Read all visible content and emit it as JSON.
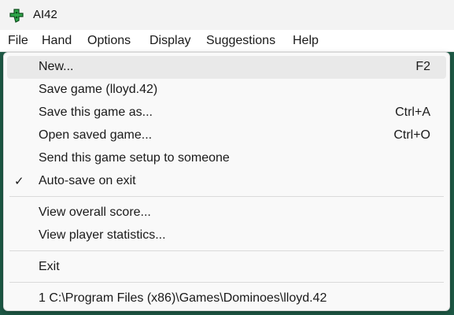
{
  "window": {
    "title": "AI42",
    "icon": "green-domino-app-icon"
  },
  "menubar": {
    "items": [
      "File",
      "Hand",
      "Options",
      "Display",
      "Suggestions",
      "Help"
    ],
    "active": "File"
  },
  "file_menu": {
    "items": [
      {
        "label": "New...",
        "shortcut": "F2",
        "highlighted": true
      },
      {
        "label": "Save game (lloyd.42)",
        "shortcut": ""
      },
      {
        "label": "Save this game as...",
        "shortcut": "Ctrl+A"
      },
      {
        "label": "Open saved game...",
        "shortcut": "Ctrl+O"
      },
      {
        "label": "Send this game setup to someone",
        "shortcut": ""
      },
      {
        "label": "Auto-save on exit",
        "shortcut": "",
        "checked": true,
        "check_mark": "✓"
      },
      {
        "label": "View overall score...",
        "shortcut": ""
      },
      {
        "label": "View player statistics...",
        "shortcut": ""
      },
      {
        "label": "Exit",
        "shortcut": ""
      },
      {
        "label": "1 C:\\Program Files (x86)\\Games\\Dominoes\\lloyd.42",
        "shortcut": ""
      }
    ]
  },
  "colors": {
    "background": "#1e5a46",
    "menu_bg": "#f9f9f9",
    "highlight": "#e9e9e9",
    "titlebar": "#f3f3f3"
  }
}
